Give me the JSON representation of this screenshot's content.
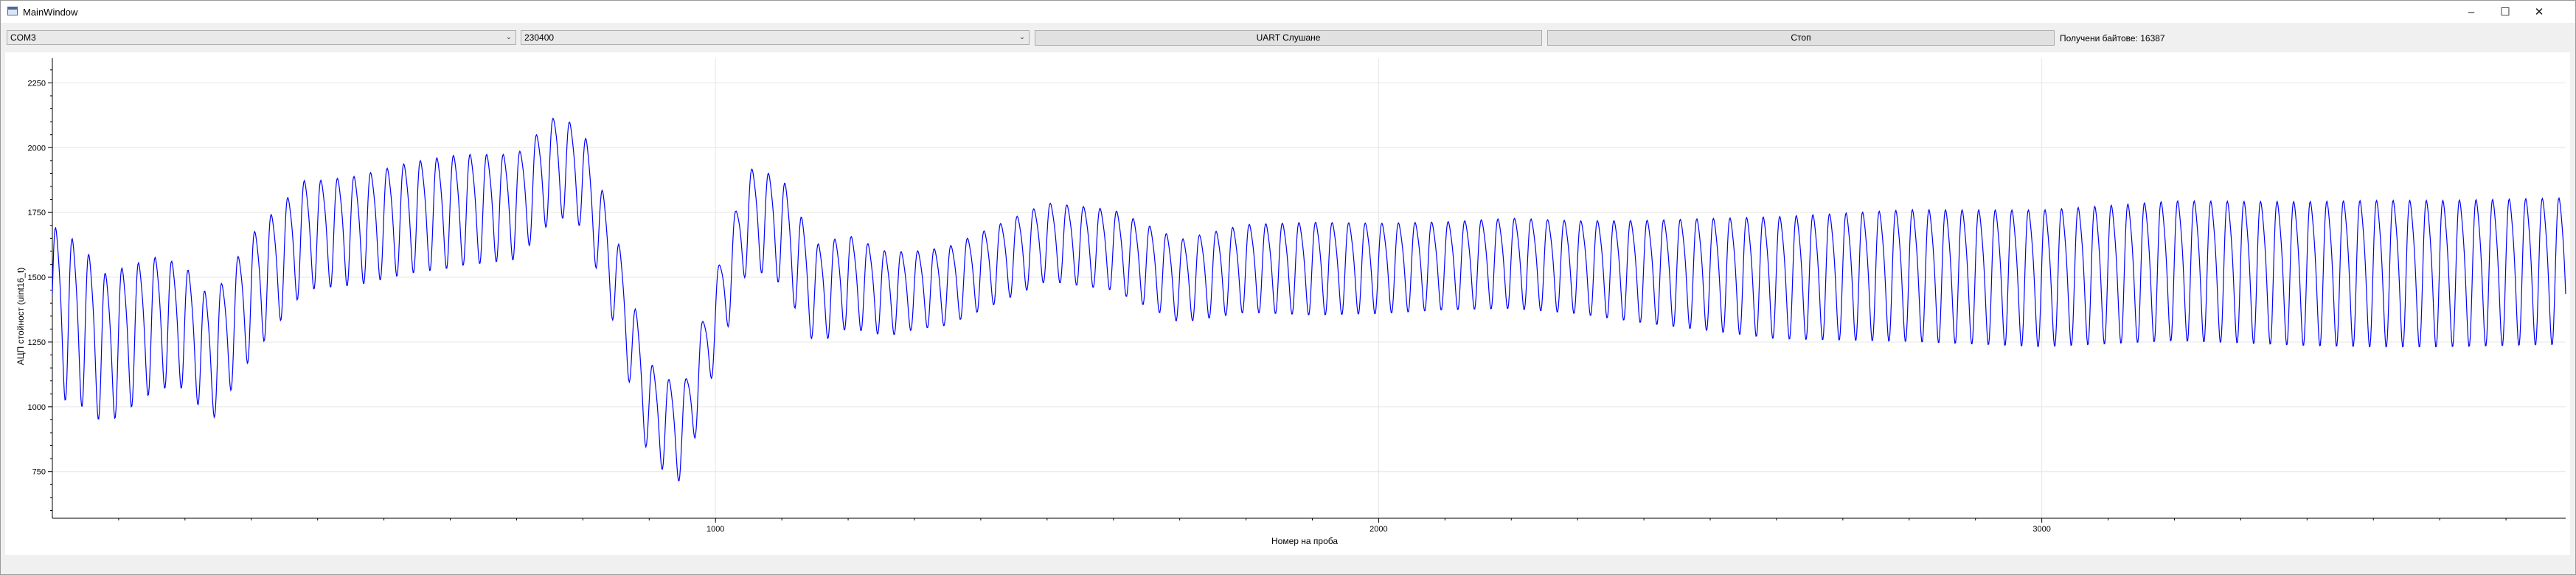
{
  "window": {
    "title": "MainWindow",
    "icon": "app-window-icon",
    "controls": {
      "minimize": "–",
      "maximize": "☐",
      "close": "✕"
    }
  },
  "toolbar": {
    "port_select": {
      "value": "COM3"
    },
    "baud_select": {
      "value": "230400"
    },
    "listen_button": "UART Слушане",
    "stop_button": "Стоп",
    "bytes_received": "Получени байтове: 16387"
  },
  "colors": {
    "series": "#0000ff",
    "grid": "#e6e6e6",
    "axis": "#000000",
    "background": "#ffffff"
  },
  "chart_data": {
    "type": "line",
    "title": "",
    "xlabel": "Номер на проба",
    "ylabel": "АЦП стойност (uint16_t)",
    "xlim": [
      0,
      3790
    ],
    "ylim": [
      570,
      2345
    ],
    "grid": true,
    "x_ticks": [
      1000,
      2000,
      3000
    ],
    "y_ticks": [
      750,
      1000,
      1250,
      1500,
      1750,
      2000,
      2250
    ],
    "series": [
      {
        "oscillation_period_samples": 25,
        "center_profile": [
          [
            0,
            1400
          ],
          [
            40,
            1350
          ],
          [
            80,
            1250
          ],
          [
            160,
            1350
          ],
          [
            200,
            1330
          ],
          [
            240,
            1200
          ],
          [
            300,
            1450
          ],
          [
            380,
            1680
          ],
          [
            460,
            1700
          ],
          [
            540,
            1750
          ],
          [
            620,
            1780
          ],
          [
            700,
            1790
          ],
          [
            760,
            1950
          ],
          [
            800,
            1900
          ],
          [
            850,
            1500
          ],
          [
            900,
            1000
          ],
          [
            950,
            900
          ],
          [
            1000,
            1350
          ],
          [
            1050,
            1750
          ],
          [
            1100,
            1700
          ],
          [
            1150,
            1450
          ],
          [
            1200,
            1500
          ],
          [
            1260,
            1450
          ],
          [
            1350,
            1480
          ],
          [
            1500,
            1650
          ],
          [
            1600,
            1620
          ],
          [
            1700,
            1500
          ],
          [
            1800,
            1550
          ],
          [
            2000,
            1550
          ],
          [
            2200,
            1570
          ],
          [
            2400,
            1540
          ],
          [
            2600,
            1520
          ],
          [
            2800,
            1530
          ],
          [
            3000,
            1520
          ],
          [
            3200,
            1550
          ],
          [
            3400,
            1540
          ],
          [
            3600,
            1540
          ],
          [
            3790,
            1550
          ]
        ],
        "amplitude_profile": [
          [
            0,
            350
          ],
          [
            100,
            300
          ],
          [
            200,
            250
          ],
          [
            300,
            250
          ],
          [
            400,
            220
          ],
          [
            600,
            230
          ],
          [
            800,
            200
          ],
          [
            900,
            200
          ],
          [
            1000,
            180
          ],
          [
            1100,
            220
          ],
          [
            1300,
            160
          ],
          [
            1500,
            160
          ],
          [
            1700,
            170
          ],
          [
            1900,
            190
          ],
          [
            2100,
            180
          ],
          [
            2300,
            190
          ],
          [
            2600,
            250
          ],
          [
            2800,
            270
          ],
          [
            3000,
            280
          ],
          [
            3300,
            290
          ],
          [
            3500,
            300
          ],
          [
            3790,
            300
          ]
        ]
      }
    ]
  }
}
